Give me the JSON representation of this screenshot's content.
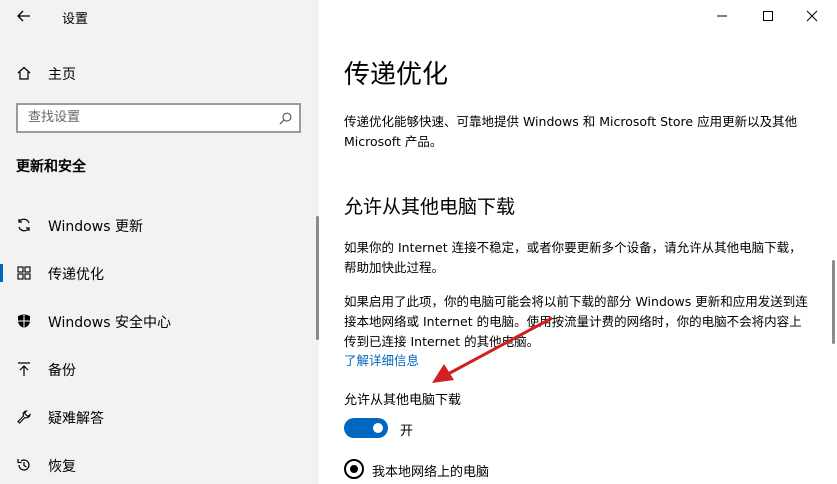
{
  "window": {
    "title": "设置"
  },
  "sidebar": {
    "home_label": "主页",
    "search": {
      "placeholder": "查找设置",
      "value": ""
    },
    "section_title": "更新和安全",
    "items": [
      {
        "label": "Windows 更新",
        "icon": "sync-icon"
      },
      {
        "label": "传递优化",
        "icon": "delivery-icon",
        "active": true
      },
      {
        "label": "Windows 安全中心",
        "icon": "shield-icon"
      },
      {
        "label": "备份",
        "icon": "upload-icon"
      },
      {
        "label": "疑难解答",
        "icon": "wrench-icon"
      },
      {
        "label": "恢复",
        "icon": "history-icon"
      }
    ]
  },
  "main": {
    "title": "传递优化",
    "description": "传递优化能够快速、可靠地提供 Windows 和 Microsoft Store 应用更新以及其他 Microsoft 产品。",
    "section_title": "允许从其他电脑下载",
    "paragraph1": "如果你的 Internet 连接不稳定，或者你要更新多个设备，请允许从其他电脑下载，帮助加快此过程。",
    "paragraph2": "如果启用了此项，你的电脑可能会将以前下载的部分 Windows 更新和应用发送到连接本地网络或 Internet 的电脑。使用按流量计费的网络时，你的电脑不会将内容上传到已连接 Internet 的其他电脑。",
    "learn_more": "了解详细信息",
    "toggle_label": "允许从其他电脑下载",
    "toggle_state": "开",
    "radio_option": "我本地网络上的电脑"
  },
  "colors": {
    "accent": "#0067c0",
    "annotation": "#d21f1f"
  }
}
